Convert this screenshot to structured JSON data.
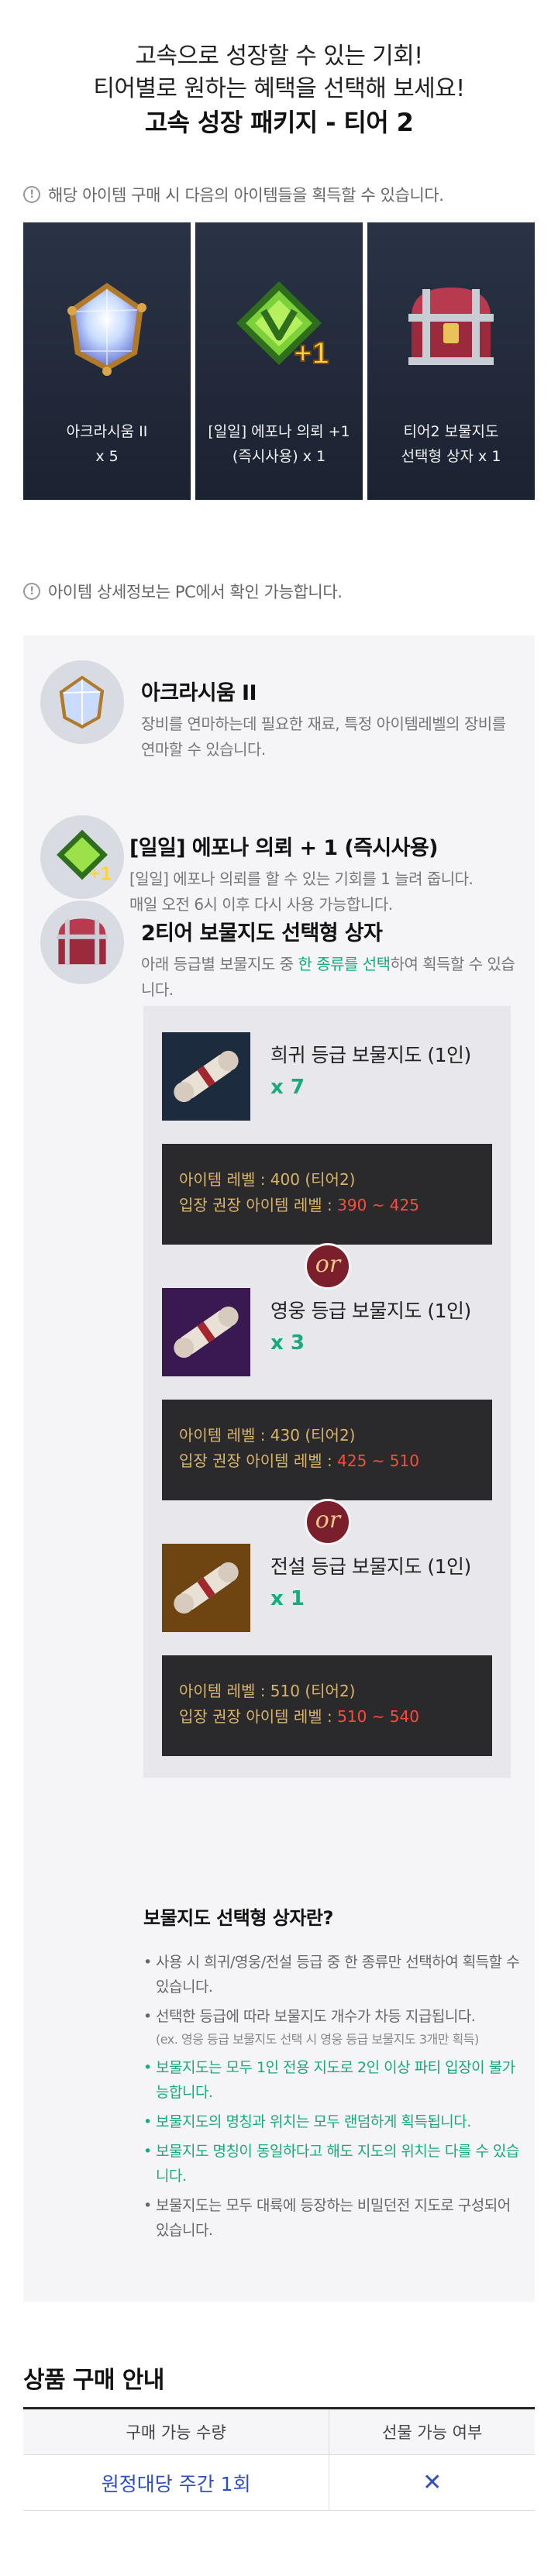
{
  "hero": {
    "line1": "고속으로 성장할 수 있는 기회!",
    "line2": "티어별로 원하는 혜택을 선택해 보세요!",
    "title": "고속 성장 패키지 - 티어 2"
  },
  "notice_acquire": "해당 아이템 구매 시 다음의 아이템들을 획득할 수 있습니다.",
  "cards": [
    {
      "line1": "아크라시움 II",
      "line2": "x 5"
    },
    {
      "line1": "[일일] 에포나 의뢰 +1",
      "line2": "(즉시사용) x 1"
    },
    {
      "line1": "티어2 보물지도",
      "line2": "선택형 상자 x 1"
    }
  ],
  "notice_pc": "아이템 상세정보는 PC에서 확인 가능합니다.",
  "details": [
    {
      "title": "아크라시움 II",
      "desc": "장비를 연마하는데 필요한 재료, 특정 아이템레벨의 장비를 연마할 수 있습니다."
    },
    {
      "title": "[일일] 에포나 의뢰 + 1 (즉시사용)",
      "desc1": "[일일] 에포나 의뢰를 할 수 있는 기회를 1 늘려 줍니다.",
      "desc2": "매일 오전 6시 이후 다시 사용 가능합니다."
    },
    {
      "title": "2티어 보물지도 선택형 상자",
      "desc_pre": "아래 등급별 보물지도 중 ",
      "desc_hl": "한 종류를 선택",
      "desc_post": "하여 획득할 수 있습니다."
    }
  ],
  "maps": [
    {
      "name": "희귀 등급 보물지도 (1인)",
      "qty": "x 7",
      "level": "아이템 레벨 : 400 (티어2)",
      "rec_label": "입장 권장 아이템 레벨 : ",
      "rec_range": "390 ~ 425",
      "color": "#1c2c3e"
    },
    {
      "name": "영웅 등급 보물지도 (1인)",
      "qty": "x 3",
      "level": "아이템 레벨 : 430 (티어2)",
      "rec_label": "입장 권장 아이템 레벨 : ",
      "rec_range": "425 ~ 510",
      "color": "#3a1850"
    },
    {
      "name": "전설 등급 보물지도 (1인)",
      "qty": "x 1",
      "level": "아이템 레벨 : 510 (티어2)",
      "rec_label": "입장 권장 아이템 레벨 : ",
      "rec_range": "510 ~ 540",
      "color": "#6e4410"
    }
  ],
  "or_label": "or",
  "info": {
    "title": "보물지도 선택형 상자란?",
    "items": [
      "사용 시 희귀/영웅/전설 등급 중 한 종류만 선택하여 획득할 수 있습니다.",
      "선택한 등급에 따라 보물지도 개수가 차등 지급됩니다.",
      "(ex. 영웅 등급 보물지도 선택 시 영웅 등급 보물지도 3개만 획득)",
      "보물지도는 모두 1인 전용 지도로 2인 이상 파티 입장이 불가능합니다.",
      "보물지도의 명칭과 위치는 모두 랜덤하게 획득됩니다.",
      "보물지도 명칭이 동일하다고 해도 지도의 위치는 다를 수 있습니다.",
      "보물지도는 모두 대륙에 등장하는 비밀던전 지도로 구성되어 있습니다."
    ]
  },
  "purchase": {
    "title": "상품 구매 안내",
    "col1": "구매 가능 수량",
    "col2": "선물 가능 여부",
    "val1": "원정대당 주간 1회",
    "val2": "✕"
  },
  "colors": {
    "accent_green": "#19a97d",
    "range_red": "#ff4a3a",
    "link_blue": "#2f4fc4",
    "or_badge": "#7a1f2b"
  },
  "icons": [
    "info-icon",
    "gem-icon",
    "epona-badge-icon",
    "treasure-chest-icon",
    "scroll-map-icon",
    "close-x-icon"
  ]
}
